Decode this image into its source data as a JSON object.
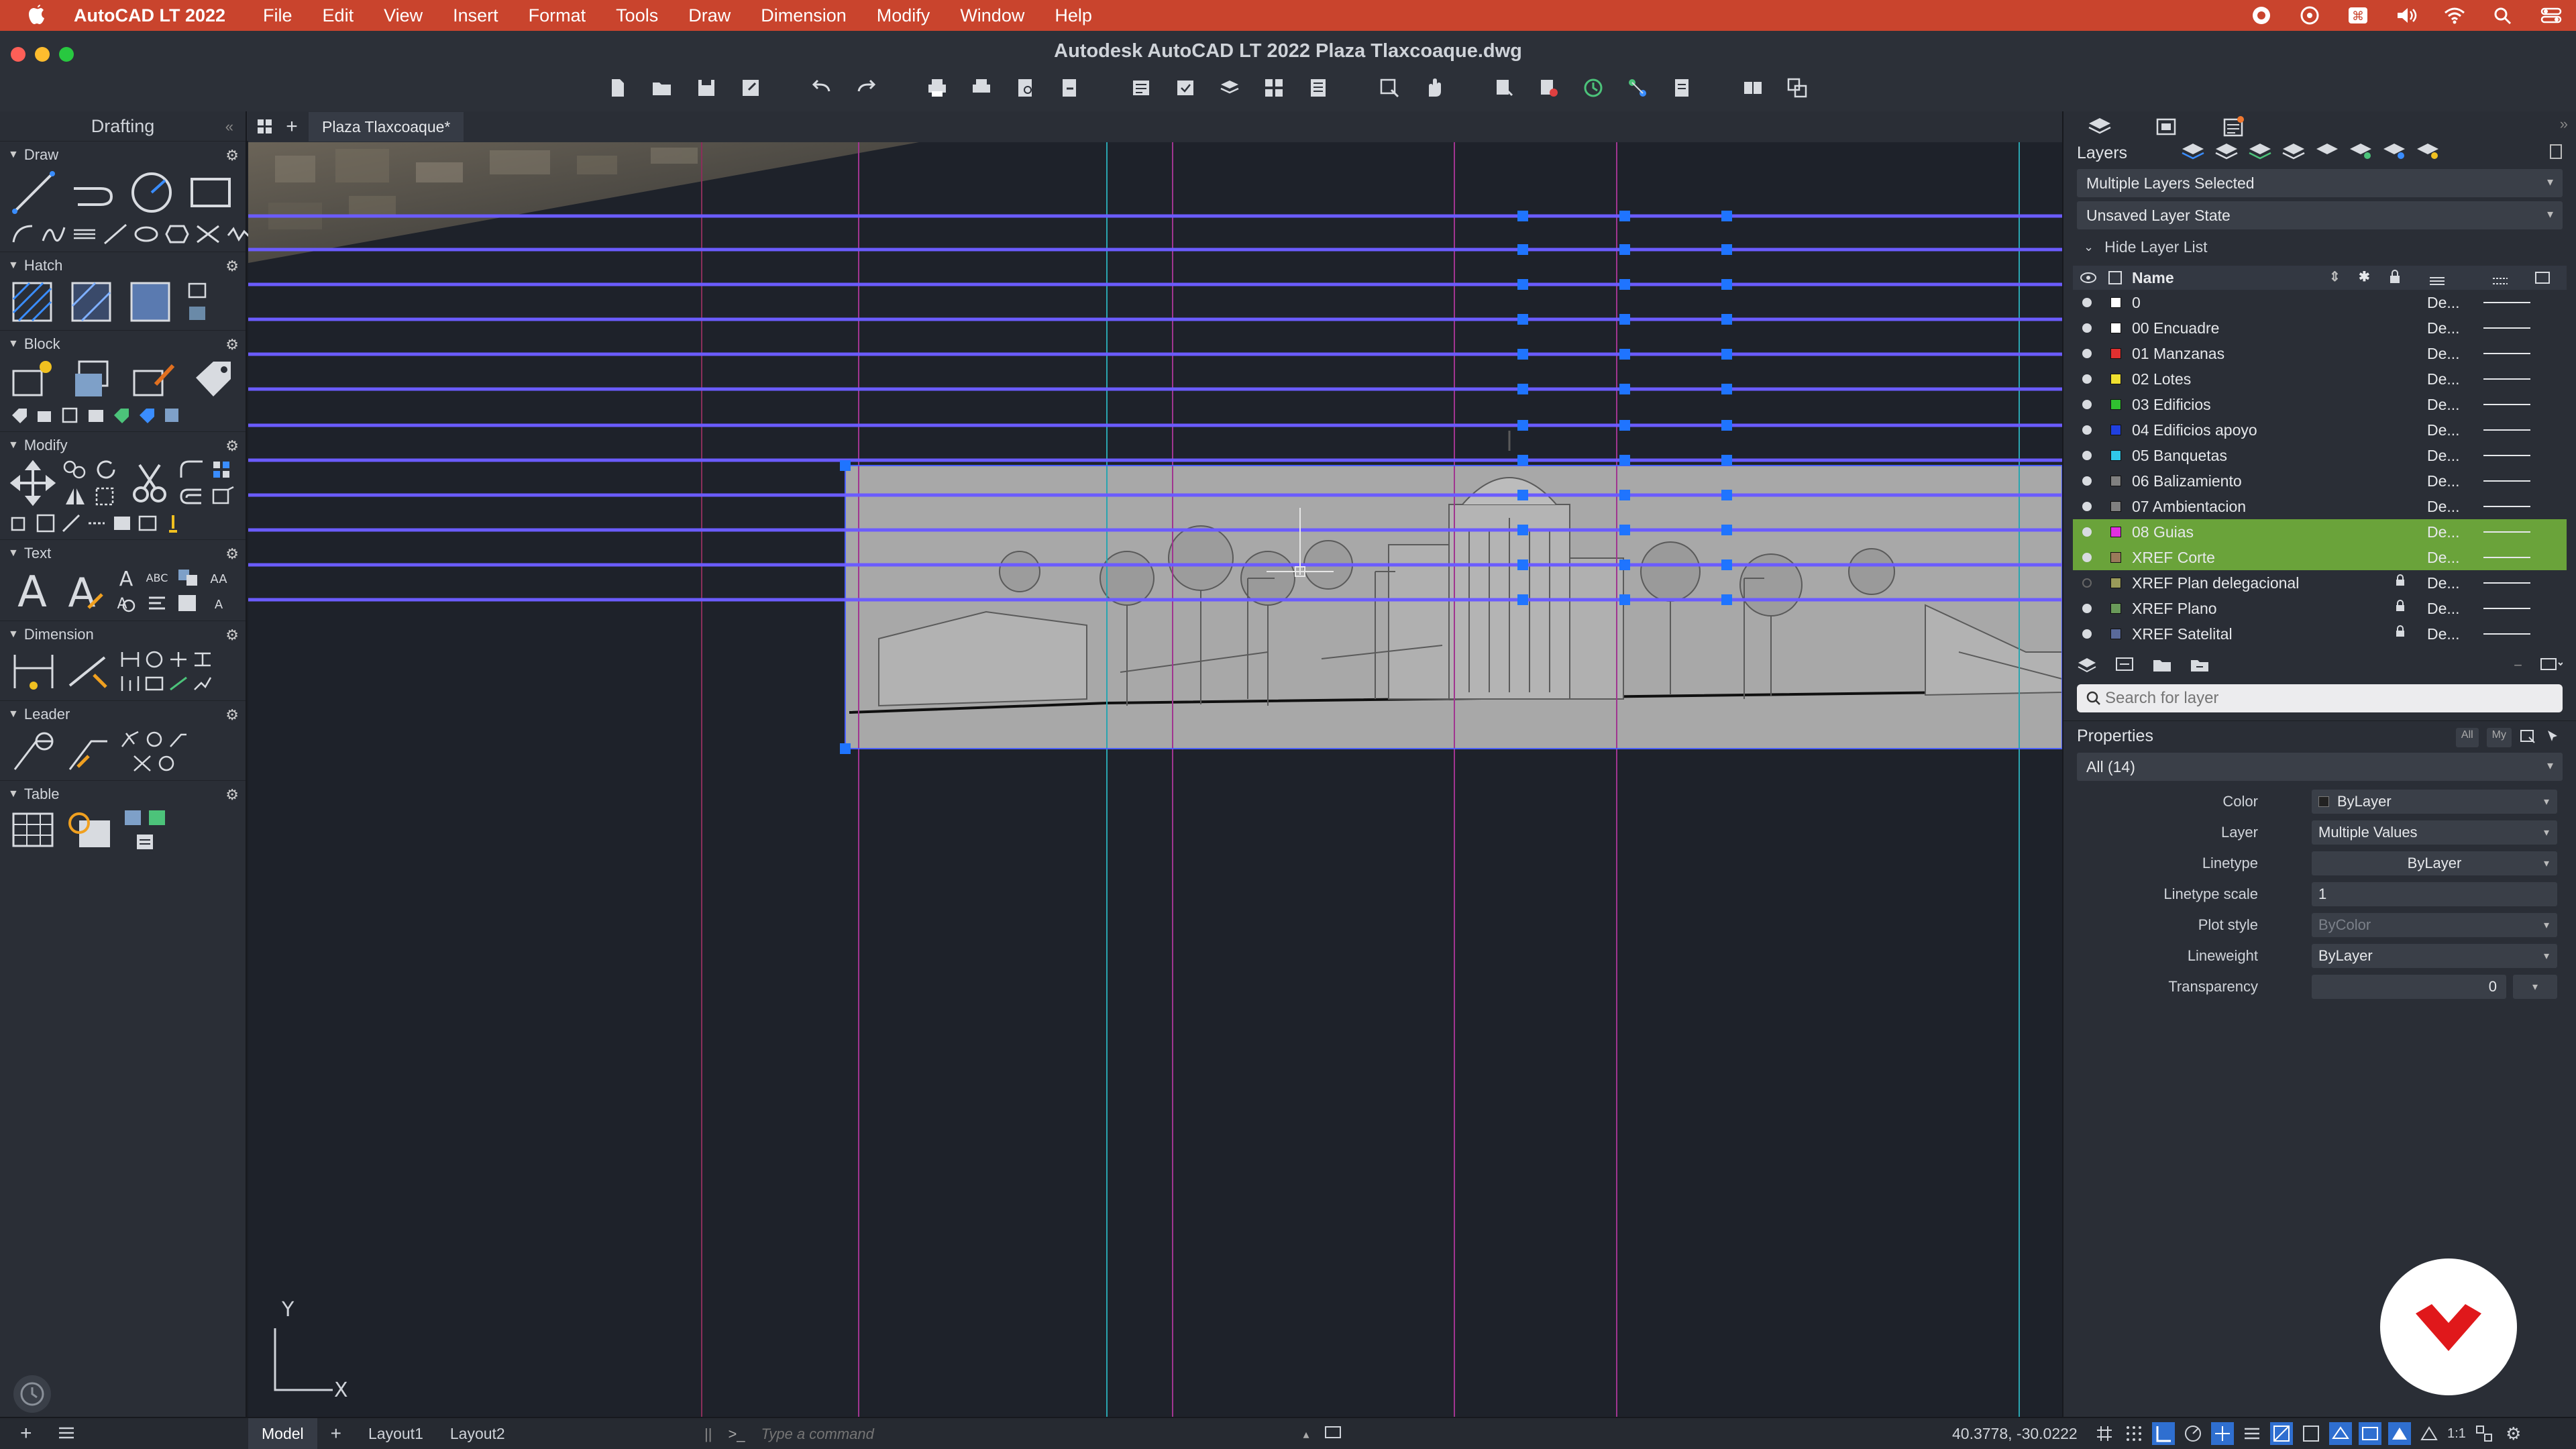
{
  "menubar": {
    "app_name": "AutoCAD LT 2022",
    "items": [
      "File",
      "Edit",
      "View",
      "Insert",
      "Format",
      "Tools",
      "Draw",
      "Dimension",
      "Modify",
      "Window",
      "Help"
    ]
  },
  "window": {
    "title": "Autodesk AutoCAD LT 2022   Plaza Tlaxcoaque.dwg"
  },
  "left_panel": {
    "title": "Drafting",
    "sections": [
      "Draw",
      "Hatch",
      "Block",
      "Modify",
      "Text",
      "Dimension",
      "Leader",
      "Table"
    ]
  },
  "tabs": {
    "active": "Plaza Tlaxcoaque*"
  },
  "canvas": {
    "ucs_y": "Y",
    "ucs_x": "X"
  },
  "status": {
    "model_tab": "Model",
    "layout1": "Layout1",
    "layout2": "Layout2",
    "command_prompt": ">_",
    "command_placeholder": "Type a command",
    "coordinates": "40.3778, -30.0222",
    "scale": "1:1"
  },
  "layers_panel": {
    "title": "Layers",
    "layer_selector": "Multiple Layers Selected",
    "layer_state": "Unsaved Layer State",
    "hide_list": "Hide Layer List",
    "name_col": "Name",
    "search_placeholder": "Search for layer",
    "layers": [
      {
        "name": "0",
        "color": "#ffffff",
        "linetype": "De...",
        "selected": false,
        "locked": false,
        "on": true
      },
      {
        "name": "00 Encuadre",
        "color": "#ffffff",
        "linetype": "De...",
        "selected": false,
        "locked": false,
        "on": true
      },
      {
        "name": "01 Manzanas",
        "color": "#e03030",
        "linetype": "De...",
        "selected": false,
        "locked": false,
        "on": true
      },
      {
        "name": "02 Lotes",
        "color": "#f0e030",
        "linetype": "De...",
        "selected": false,
        "locked": false,
        "on": true
      },
      {
        "name": "03 Edificios",
        "color": "#30c030",
        "linetype": "De...",
        "selected": false,
        "locked": false,
        "on": true
      },
      {
        "name": "04 Edificios apoyo",
        "color": "#2040e0",
        "linetype": "De...",
        "selected": false,
        "locked": false,
        "on": true
      },
      {
        "name": "05 Banquetas",
        "color": "#30c8e8",
        "linetype": "De...",
        "selected": false,
        "locked": false,
        "on": true
      },
      {
        "name": "06 Balizamiento",
        "color": "#808080",
        "linetype": "De...",
        "selected": false,
        "locked": false,
        "on": true
      },
      {
        "name": "07 Ambientacion",
        "color": "#808080",
        "linetype": "De...",
        "selected": false,
        "locked": false,
        "on": true
      },
      {
        "name": "08 Guias",
        "color": "#e030e0",
        "linetype": "De...",
        "selected": true,
        "locked": false,
        "on": true
      },
      {
        "name": "XREF Corte",
        "color": "#9a7a5a",
        "linetype": "De...",
        "selected": true,
        "locked": false,
        "on": true
      },
      {
        "name": "XREF Plan delegacional",
        "color": "#9a9a5a",
        "linetype": "De...",
        "selected": false,
        "locked": true,
        "on": false
      },
      {
        "name": "XREF Plano",
        "color": "#6a9a5a",
        "linetype": "De...",
        "selected": false,
        "locked": true,
        "on": true
      },
      {
        "name": "XREF Satelital",
        "color": "#5a6a9a",
        "linetype": "De...",
        "selected": false,
        "locked": true,
        "on": true
      }
    ]
  },
  "properties_panel": {
    "title": "Properties",
    "btn_all": "All",
    "btn_my": "My",
    "filter": "All (14)",
    "rows": [
      {
        "label": "Color",
        "value": "ByLayer"
      },
      {
        "label": "Layer",
        "value": "Multiple Values"
      },
      {
        "label": "Linetype",
        "value": "ByLayer"
      },
      {
        "label": "Linetype scale",
        "value": "1"
      },
      {
        "label": "Plot style",
        "value": "ByColor"
      },
      {
        "label": "Lineweight",
        "value": "ByLayer"
      },
      {
        "label": "Transparency",
        "value": "0"
      }
    ]
  },
  "colors": {
    "menubar": "#c9442d",
    "selection": "#6aa33a",
    "guide_line": "#6b5cff",
    "grip": "#1f74ff"
  }
}
